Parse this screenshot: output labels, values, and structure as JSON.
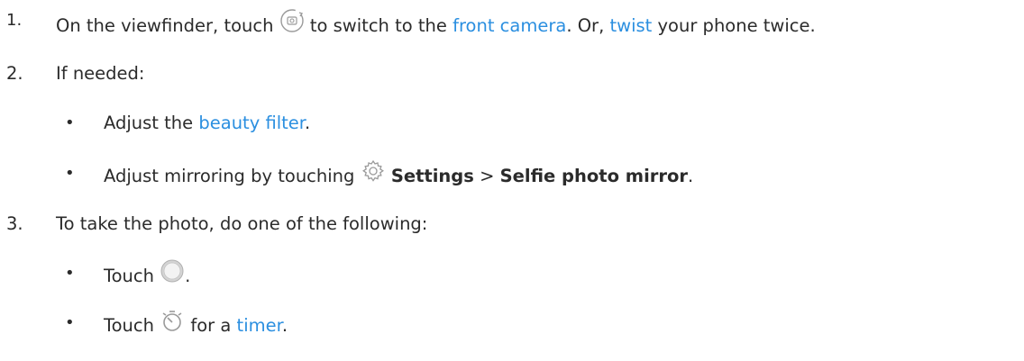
{
  "steps": [
    {
      "number": "1.",
      "pre": "On the viewfinder, touch",
      "icon": "switch-camera-icon",
      "mid": "to switch to the",
      "link1": "front camera",
      "mid2": ". Or,",
      "link2": "twist",
      "post": "your phone twice."
    },
    {
      "number": "2.",
      "text": "If needed:",
      "bullets": [
        {
          "pre": "Adjust the",
          "link": "beauty filter",
          "post": "."
        },
        {
          "pre": "Adjust mirroring by touching",
          "icon": "settings-gear-icon",
          "bold1": "Settings",
          "sep": ">",
          "bold2": "Selfie photo mirror",
          "post": "."
        }
      ]
    },
    {
      "number": "3.",
      "text": "To take the photo, do one of the following:",
      "bullets": [
        {
          "pre": "Touch",
          "icon": "shutter-button-icon",
          "post": "."
        },
        {
          "pre": "Touch",
          "icon": "timer-icon",
          "mid": "for a",
          "link": "timer",
          "post": "."
        }
      ]
    }
  ],
  "bullet_char": "•",
  "colors": {
    "text": "#2b2b2b",
    "link": "#2b8fe0",
    "icon": "#9a9a9a"
  }
}
